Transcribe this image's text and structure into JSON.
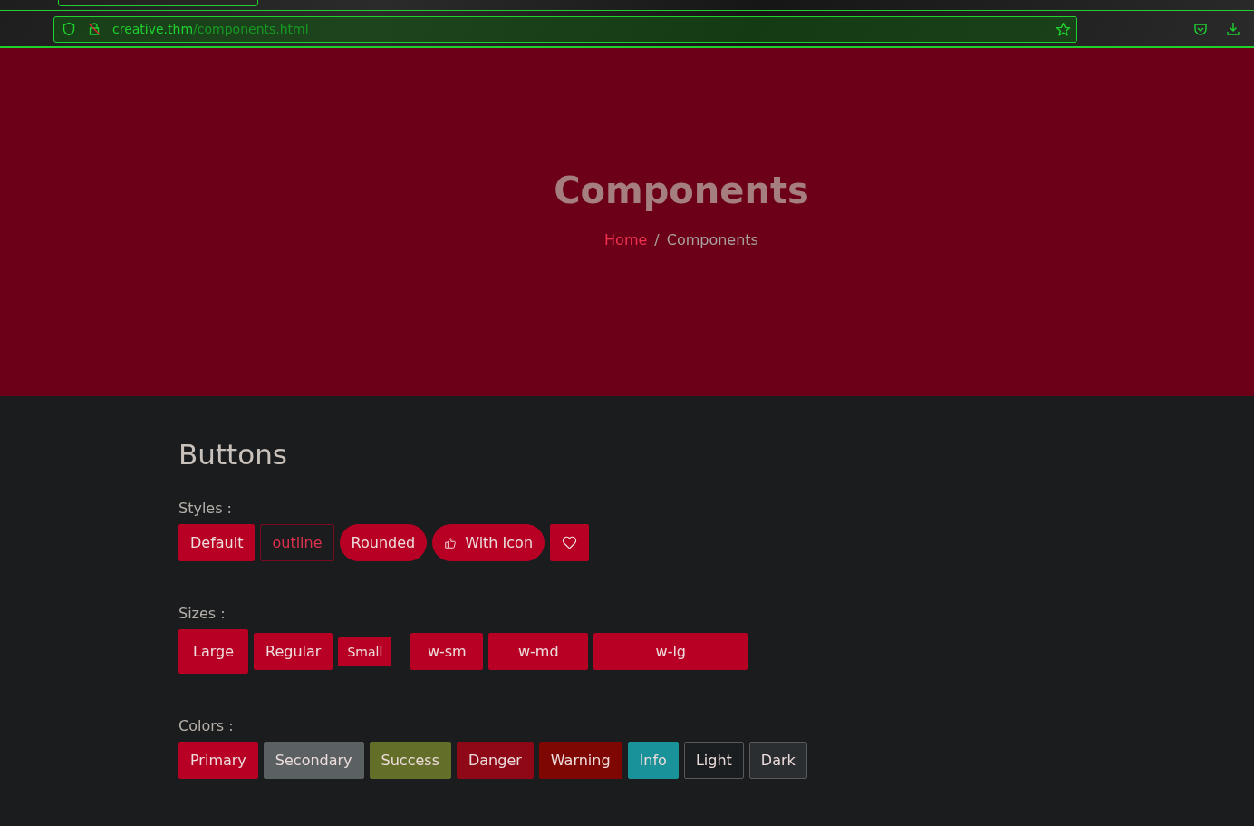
{
  "browser": {
    "url_host": "creative.thm",
    "url_path": "/components.html"
  },
  "hero": {
    "title": "Components",
    "breadcrumb_separator": "/",
    "breadcrumb": [
      {
        "label": "Home",
        "kind": "link"
      },
      {
        "label": "Components",
        "kind": "current"
      }
    ]
  },
  "section": {
    "title": "Buttons",
    "groups": [
      {
        "label": "Styles :",
        "buttons": [
          {
            "label": "Default",
            "kind": "solid"
          },
          {
            "label": "outline",
            "kind": "outline"
          },
          {
            "label": "Rounded",
            "kind": "rounded"
          },
          {
            "label": "With Icon",
            "kind": "icon"
          },
          {
            "kind": "icon-only"
          }
        ]
      },
      {
        "label": "Sizes :",
        "buttons": [
          {
            "label": "Large",
            "kind": "lg"
          },
          {
            "label": "Regular",
            "kind": "md"
          },
          {
            "label": "Small",
            "kind": "sm"
          },
          {
            "label": "w-sm",
            "kind": "w-sm"
          },
          {
            "label": "w-md",
            "kind": "w-md"
          },
          {
            "label": "w-lg",
            "kind": "w-lg"
          }
        ]
      },
      {
        "label": "Colors :",
        "buttons": [
          {
            "label": "Primary",
            "kind": "solid",
            "color": "#b80024"
          },
          {
            "label": "Secondary",
            "kind": "solid",
            "color": "#5b6163"
          },
          {
            "label": "Success",
            "kind": "solid",
            "color": "#636e28"
          },
          {
            "label": "Danger",
            "kind": "solid",
            "color": "#8f0818"
          },
          {
            "label": "Warning",
            "kind": "solid",
            "color": "#7e0704"
          },
          {
            "label": "Info",
            "kind": "solid",
            "color": "#1a9299"
          },
          {
            "label": "Light",
            "kind": "solid",
            "color": "#1b1e20"
          },
          {
            "label": "Dark",
            "kind": "solid",
            "color": "#2a2e31"
          }
        ]
      }
    ]
  }
}
